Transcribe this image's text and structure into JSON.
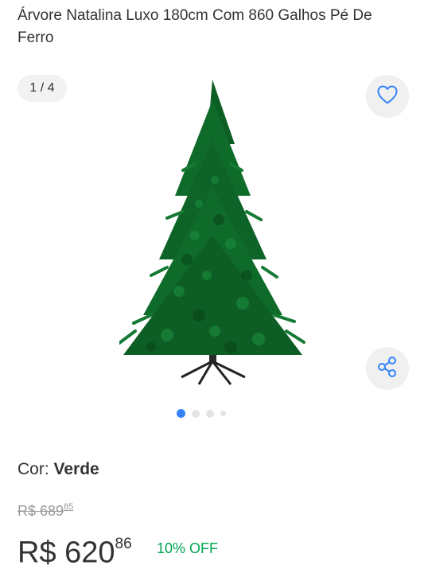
{
  "product": {
    "title": "Árvore Natalina Luxo 180cm Com 860 Galhos Pé De Ferro",
    "gallery_counter": "1 / 4",
    "image": "christmas-tree-photo"
  },
  "gallery": {
    "total": 4,
    "active": 1
  },
  "variant": {
    "label": "Cor:",
    "value": "Verde"
  },
  "price": {
    "original_main": "R$ 689",
    "original_cents": "85",
    "current_main": "R$ 620",
    "current_cents": "86",
    "discount": "10% OFF"
  },
  "colors": {
    "accent": "#3483fa",
    "discount": "#00a650",
    "text": "#333333"
  },
  "icons": {
    "favorite": "heart-icon",
    "share": "share-icon"
  }
}
